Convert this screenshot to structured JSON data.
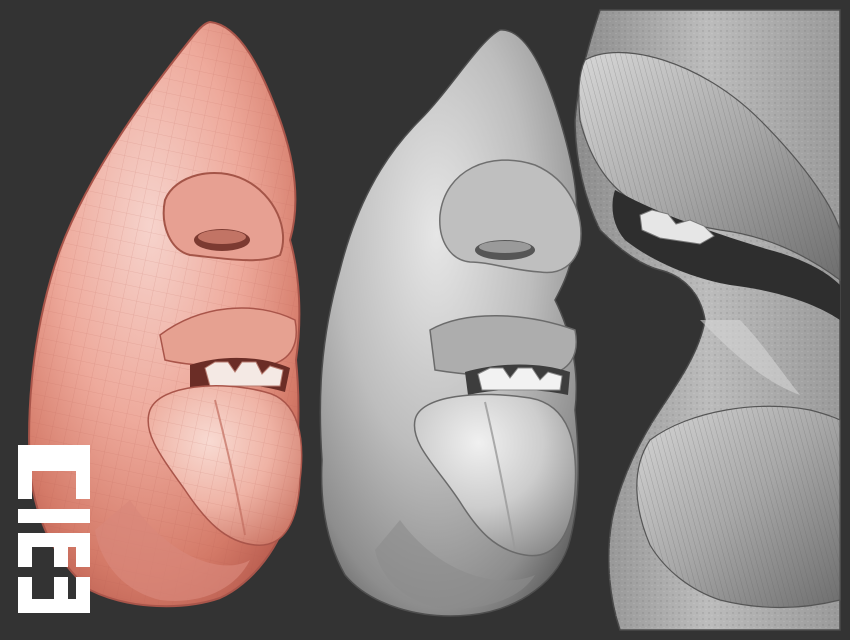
{
  "scene": {
    "background_color": "#333333",
    "panels": [
      {
        "name": "low-poly-mouth-sculpt",
        "base_color": "#d98070",
        "highlight_color": "#f2b8ad"
      },
      {
        "name": "smooth-mouth-sculpt",
        "base_color": "#8a8a8a",
        "highlight_color": "#d9d9d9"
      },
      {
        "name": "detailed-lips-closeup",
        "base_color": "#7a7a7a",
        "highlight_color": "#cfcfcf"
      }
    ]
  },
  "logo": {
    "text": "CIEI",
    "color": "#ffffff",
    "icon": "ciei-logo"
  }
}
